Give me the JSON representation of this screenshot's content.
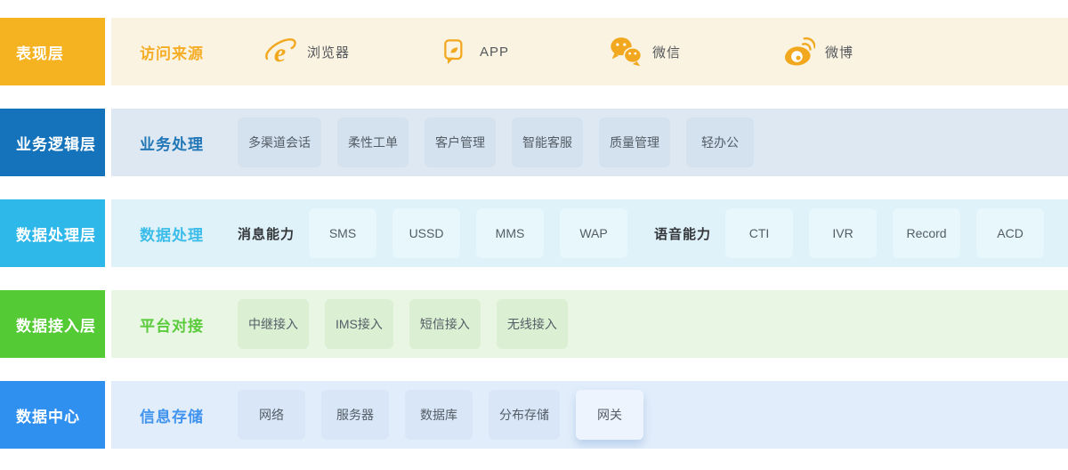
{
  "rows": [
    {
      "id": "presentation",
      "label": "表现层",
      "category": "访问来源",
      "theme": {
        "label_bg": "#f5b221",
        "row_bg": "#faf3e1",
        "category_color": "#f5ad26",
        "icon_color": "#f2a81e"
      },
      "items": [
        {
          "icon": "ie-browser-icon",
          "text": "浏览器"
        },
        {
          "icon": "app-icon",
          "text": "APP"
        },
        {
          "icon": "wechat-icon",
          "text": "微信"
        },
        {
          "icon": "weibo-icon",
          "text": "微博"
        }
      ]
    },
    {
      "id": "business-logic",
      "label": "业务逻辑层",
      "category": "业务处理",
      "theme": {
        "label_bg": "#1473ba",
        "row_bg": "#dee8f2",
        "chip_bg": "#d4e2ef",
        "category_color": "#2277b7"
      },
      "chips": [
        "多渠道会话",
        "柔性工单",
        "客户管理",
        "智能客服",
        "质量管理",
        "轻办公"
      ]
    },
    {
      "id": "data-processing",
      "label": "数据处理层",
      "category": "数据处理",
      "theme": {
        "label_bg": "#2eb7e9",
        "row_bg": "#dff1f9",
        "chip_bg": "#e7f7fc",
        "category_color": "#3cbde9"
      },
      "groups": [
        {
          "title": "消息能力",
          "chips": [
            "SMS",
            "USSD",
            "MMS",
            "WAP"
          ]
        },
        {
          "title": "语音能力",
          "chips": [
            "CTI",
            "IVR",
            "Record",
            "ACD"
          ]
        }
      ]
    },
    {
      "id": "data-access",
      "label": "数据接入层",
      "category": "平台对接",
      "theme": {
        "label_bg": "#54ca35",
        "row_bg": "#e9f6e4",
        "chip_bg": "#dbf0d3",
        "category_color": "#5acb3b"
      },
      "chips": [
        "中继接入",
        "IMS接入",
        "短信接入",
        "无线接入"
      ]
    },
    {
      "id": "data-center",
      "label": "数据中心",
      "category": "信息存储",
      "theme": {
        "label_bg": "#2f90f0",
        "row_bg": "#e1edfa",
        "chip_bg": "#d8e6f7",
        "chip_highlight_bg": "#eef4fd",
        "category_color": "#4093ee"
      },
      "chips": [
        "网络",
        "服务器",
        "数据库",
        "分布存储",
        "网关"
      ],
      "highlight_chip": "网关"
    }
  ]
}
